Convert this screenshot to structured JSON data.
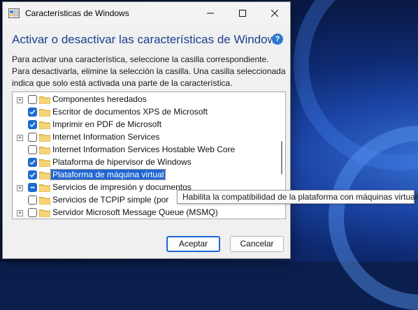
{
  "window": {
    "title": "Características de Windows",
    "heading": "Activar o desactivar las características de Windows",
    "description": "Para activar una característica, seleccione la casilla correspondiente. Para desactivarla, elimine la selección la casilla. Una casilla seleccionada indica que solo está activada una parte de la característica."
  },
  "features": [
    {
      "label": "Componentes heredados",
      "state": "unchecked",
      "expandable": true
    },
    {
      "label": "Escritor de documentos XPS de Microsoft",
      "state": "checked",
      "expandable": false
    },
    {
      "label": "Imprimir en PDF de Microsoft",
      "state": "checked",
      "expandable": false
    },
    {
      "label": "Internet Information Services",
      "state": "unchecked",
      "expandable": true
    },
    {
      "label": "Internet Information Services Hostable Web Core",
      "state": "unchecked",
      "expandable": false
    },
    {
      "label": "Plataforma de hipervisor de Windows",
      "state": "checked",
      "expandable": false
    },
    {
      "label": "Plataforma de máquina virtual",
      "state": "checked",
      "expandable": false,
      "selected": true
    },
    {
      "label": "Servicios de impresión y documentos",
      "state": "partial",
      "expandable": true
    },
    {
      "label": "Servicios de TCPIP simple (por",
      "state": "unchecked",
      "expandable": false
    },
    {
      "label": "Servidor Microsoft Message Queue (MSMQ)",
      "state": "unchecked",
      "expandable": true
    }
  ],
  "tooltip": "Habilita la compatibilidad de la plataforma con máquinas virtuales",
  "buttons": {
    "ok": "Aceptar",
    "cancel": "Cancelar"
  },
  "colors": {
    "accent": "#1f66d1",
    "heading": "#1b3f8f",
    "folder": "#f2c75c"
  }
}
